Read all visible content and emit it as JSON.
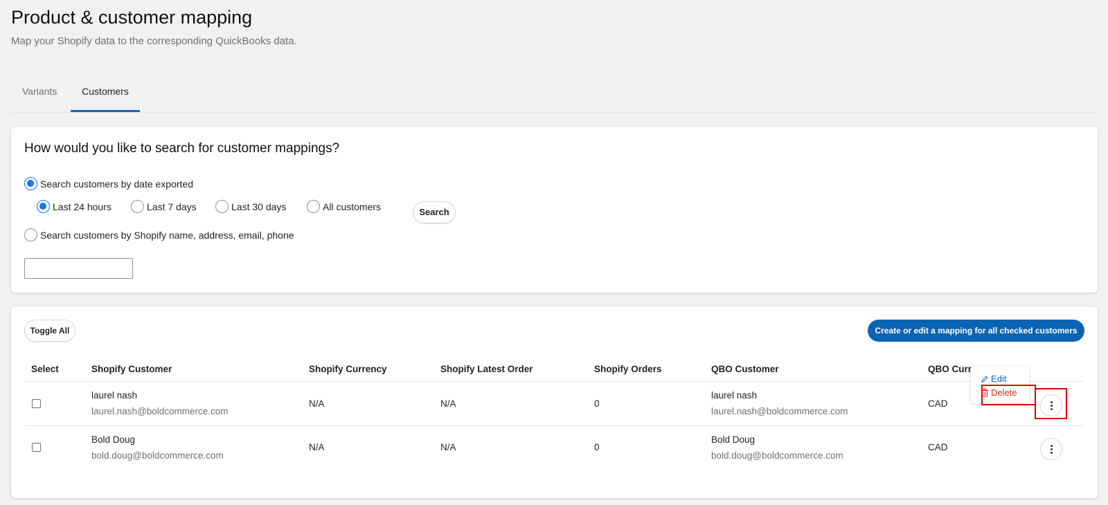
{
  "header": {
    "title": "Product & customer mapping",
    "subtitle": "Map your Shopify data to the corresponding QuickBooks data."
  },
  "tabs": [
    {
      "label": "Variants",
      "active": false
    },
    {
      "label": "Customers",
      "active": true
    }
  ],
  "search_card": {
    "heading": "How would you like to search for customer mappings?",
    "by_date_label": "Search customers by date exported",
    "by_date_checked": true,
    "ranges": [
      {
        "label": "Last 24 hours",
        "checked": true
      },
      {
        "label": "Last 7 days",
        "checked": false
      },
      {
        "label": "Last 30 days",
        "checked": false
      },
      {
        "label": "All customers",
        "checked": false
      }
    ],
    "search_button": "Search",
    "by_name_label": "Search customers by Shopify name, address, email, phone",
    "by_name_checked": false,
    "input_value": ""
  },
  "table_card": {
    "toggle_all": "Toggle All",
    "create_button": "Create or edit a mapping for all checked customers",
    "columns": [
      "Select",
      "Shopify Customer",
      "Shopify Currency",
      "Shopify Latest Order",
      "Shopify Orders",
      "QBO Customer",
      "QBO Curren"
    ],
    "rows": [
      {
        "shopify_name": "laurel nash",
        "shopify_email": "laurel.nash@boldcommerce.com",
        "shopify_currency": "N/A",
        "latest_order": "N/A",
        "orders": "0",
        "qbo_name": "laurel nash",
        "qbo_email": "laurel.nash@boldcommerce.com",
        "qbo_currency": "CAD"
      },
      {
        "shopify_name": "Bold Doug",
        "shopify_email": "bold.doug@boldcommerce.com",
        "shopify_currency": "N/A",
        "latest_order": "N/A",
        "orders": "0",
        "qbo_name": "Bold Doug",
        "qbo_email": "bold.doug@boldcommerce.com",
        "qbo_currency": "CAD"
      }
    ]
  },
  "row_menu": {
    "edit": "Edit",
    "delete": "Delete"
  },
  "colors": {
    "accent": "#1565c0",
    "primary_button": "#0b64b1",
    "danger": "#d72c0d",
    "highlight": "#e00000"
  }
}
